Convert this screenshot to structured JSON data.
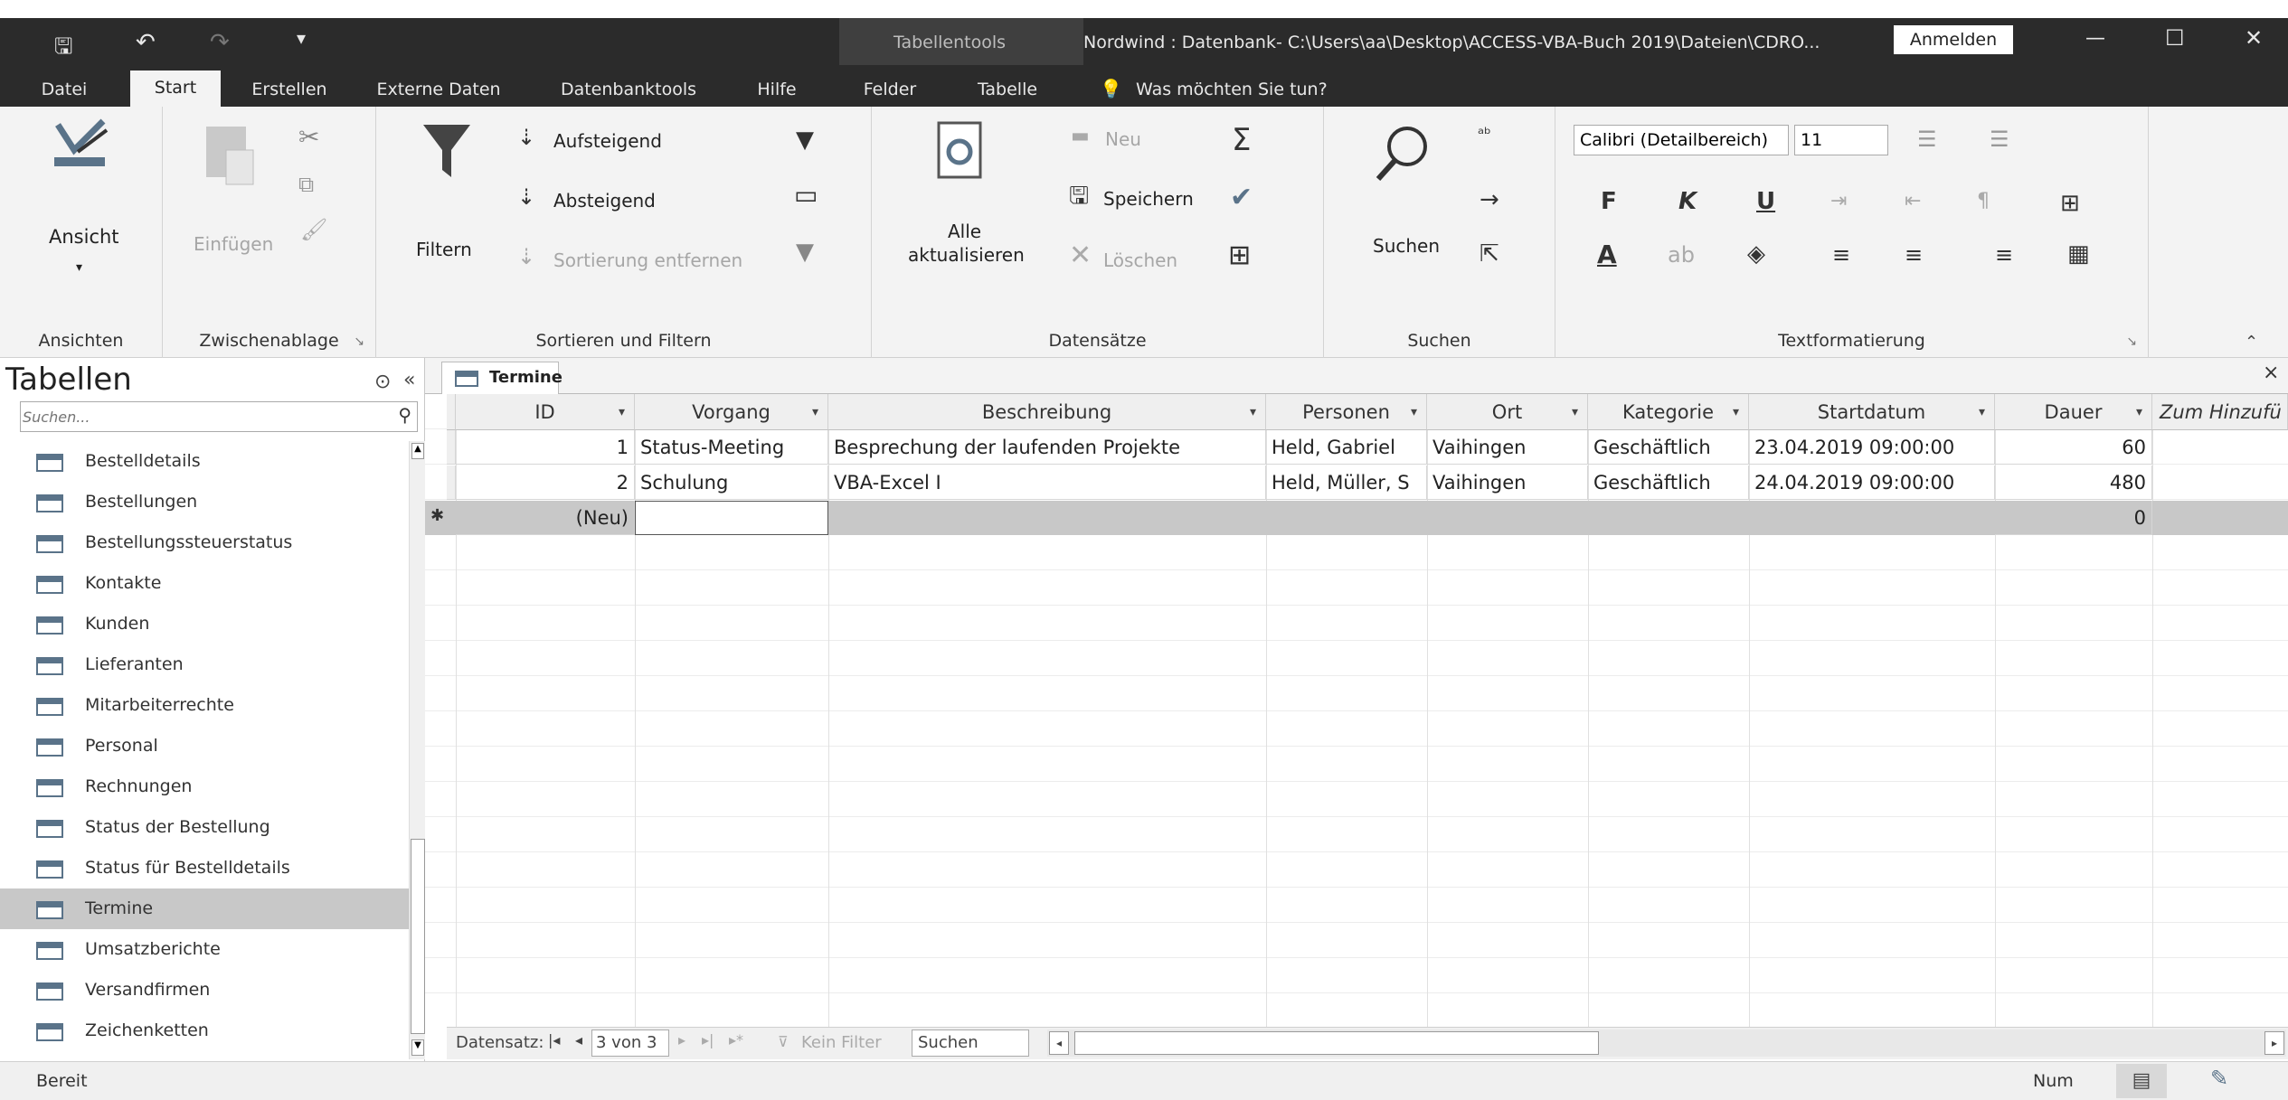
{
  "window": {
    "context_tab_title": "Tabellentools",
    "title": "Nordwind : Datenbank- C:\\Users\\aa\\Desktop\\ACCESS-VBA-Buch 2019\\Dateien\\CDRO...",
    "signin_label": "Anmelden",
    "minimize_glyph": "—",
    "maximize_glyph": "☐",
    "close_glyph": "✕"
  },
  "tabs": [
    "Datei",
    "Start",
    "Erstellen",
    "Externe Daten",
    "Datenbanktools",
    "Hilfe",
    "Felder",
    "Tabelle"
  ],
  "tell_me": "Was möchten Sie tun?",
  "ribbon": {
    "views": {
      "view_label": "Ansicht",
      "group": "Ansichten"
    },
    "clipboard": {
      "paste_label": "Einfügen",
      "group": "Zwischenablage"
    },
    "sort_filter": {
      "filter_label": "Filtern",
      "asc_label": "Aufsteigend",
      "desc_label": "Absteigend",
      "remove_sort_label": "Sortierung entfernen",
      "group": "Sortieren und Filtern"
    },
    "records": {
      "refresh_label1": "Alle",
      "refresh_label2": "aktualisieren",
      "new_label": "Neu",
      "save_label": "Speichern",
      "delete_label": "Löschen",
      "sum_glyph": "Σ",
      "group": "Datensätze"
    },
    "find": {
      "find_label": "Suchen",
      "group": "Suchen"
    },
    "text": {
      "font": "Calibri (Detailbereich)",
      "size": "11",
      "bold": "F",
      "italic": "K",
      "underline": "U",
      "font_color": "A",
      "group": "Textformatierung"
    }
  },
  "nav": {
    "title": "Tabellen",
    "search_placeholder": "Suchen...",
    "items": [
      {
        "label": "Bestelldetails",
        "selected": false
      },
      {
        "label": "Bestellungen",
        "selected": false
      },
      {
        "label": "Bestellungssteuerstatus",
        "selected": false
      },
      {
        "label": "Kontakte",
        "selected": false
      },
      {
        "label": "Kunden",
        "selected": false
      },
      {
        "label": "Lieferanten",
        "selected": false
      },
      {
        "label": "Mitarbeiterrechte",
        "selected": false
      },
      {
        "label": "Personal",
        "selected": false
      },
      {
        "label": "Rechnungen",
        "selected": false
      },
      {
        "label": "Status der Bestellung",
        "selected": false
      },
      {
        "label": "Status für Bestelldetails",
        "selected": false
      },
      {
        "label": "Termine",
        "selected": true
      },
      {
        "label": "Umsatzberichte",
        "selected": false
      },
      {
        "label": "Versandfirmen",
        "selected": false
      },
      {
        "label": "Zeichenketten",
        "selected": false
      }
    ]
  },
  "doc_tab": "Termine",
  "table": {
    "columns": [
      "ID",
      "Vorgang",
      "Beschreibung",
      "Personen",
      "Ort",
      "Kategorie",
      "Startdatum",
      "Dauer",
      "Zum Hinzufü"
    ],
    "rows": [
      [
        "1",
        "Status-Meeting",
        "Besprechung der laufenden Projekte",
        "Held, Gabriel",
        "Vaihingen",
        "Geschäftlich",
        "23.04.2019 09:00:00",
        "60"
      ],
      [
        "2",
        "Schulung",
        "VBA-Excel I",
        "Held, Müller, S",
        "Vaihingen",
        "Geschäftlich",
        "24.04.2019 09:00:00",
        "480"
      ]
    ],
    "new_row_id": "(Neu)",
    "new_row_duration": "0"
  },
  "record_nav": {
    "label": "Datensatz:",
    "position": "3 von 3",
    "filter_label": "Kein Filter",
    "search_label": "Suchen"
  },
  "status": {
    "ready": "Bereit",
    "num": "Num"
  },
  "colors": {
    "titlebar": "#2b2b2b",
    "ribbon": "#f3f3f3",
    "selected_nav": "#c8c8c8",
    "new_row": "#c8c8c8"
  }
}
